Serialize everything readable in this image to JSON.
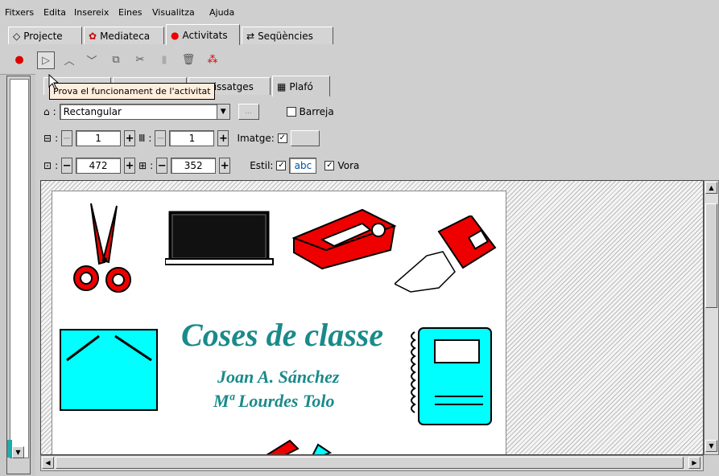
{
  "menu": [
    "Fitxers",
    "Edita",
    "Insereix",
    "Eines",
    "Visualitza",
    "Ajuda"
  ],
  "tabs": [
    {
      "label": "Projecte",
      "icon": "project-icon"
    },
    {
      "label": "Mediateca",
      "icon": "media-icon"
    },
    {
      "label": "Activitats",
      "icon": "activity-icon",
      "active": true
    },
    {
      "label": "Seqüències",
      "icon": "sequence-icon"
    }
  ],
  "toolbar": {
    "tooltip": "Prova el funcionament de l'activitat",
    "buttons": [
      "new-activity-icon",
      "play-icon",
      "up-icon",
      "down-icon",
      "copy-icon",
      "cut-icon",
      "paste-icon",
      "delete-icon",
      "structure-icon"
    ]
  },
  "subtabs": [
    {
      "label": "",
      "icon": "options-icon"
    },
    {
      "label": "",
      "icon": "window-icon"
    },
    {
      "label": "Missatges",
      "icon": "messages-icon"
    },
    {
      "label": "Plafó",
      "icon": "panel-icon",
      "active": true
    }
  ],
  "form": {
    "shape_value": "Rectangular",
    "browse_label": "...",
    "shuffle_label": "Barreja",
    "rows_value": "1",
    "cols_value": "1",
    "image_label": "Imatge:",
    "width_value": "472",
    "height_value": "352",
    "style_label": "Estil:",
    "style_sample": "abc",
    "border_label": "Vora",
    "shape_suffix": ":",
    "rows_suffix": ":",
    "cols_suffix": ":",
    "width_suffix": ":",
    "height_suffix": ":"
  },
  "panel": {
    "title": "Coses de classe",
    "author1": "Joan A. Sánchez",
    "author2": "Mª Lourdes Tolo"
  },
  "colors": {
    "accent": "#1a8a8a",
    "red": "#e00000",
    "cyan": "#00ffff"
  }
}
